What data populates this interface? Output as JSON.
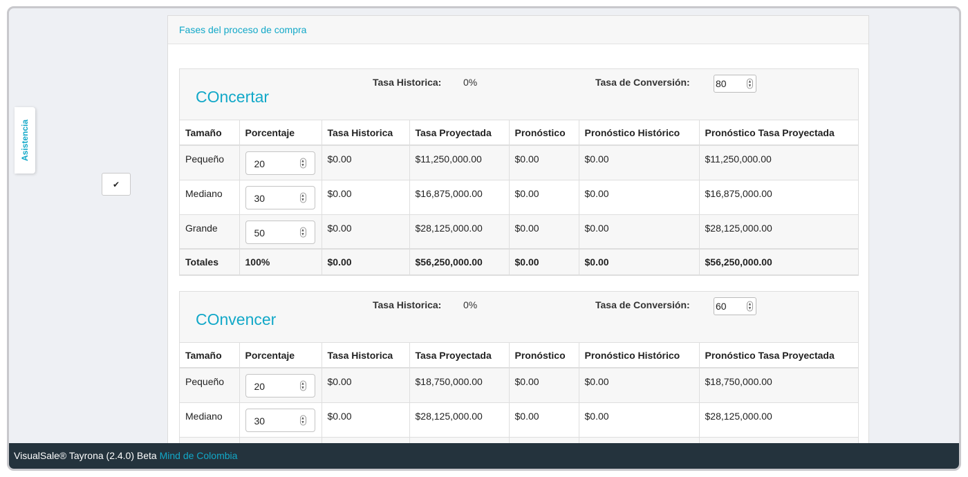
{
  "help_tab": {
    "label": "Asistencia"
  },
  "panel": {
    "title": "Fases del proceso de compra"
  },
  "columns": [
    "Tamaño",
    "Porcentaje",
    "Tasa Historica",
    "Tasa Proyectada",
    "Pronóstico",
    "Pronóstico Histórico",
    "Pronóstico Tasa Proyectada"
  ],
  "phases": [
    {
      "name": "COncertar",
      "hist_label": "Tasa Historica:",
      "hist_value": "0%",
      "conv_label": "Tasa de Conversión:",
      "conv_value": "80",
      "rows": [
        {
          "size": "Pequeño",
          "pct": "20",
          "hist": "$0.00",
          "proj": "$11,250,000.00",
          "forecast": "$0.00",
          "forecast_hist": "$0.00",
          "forecast_proj": "$11,250,000.00"
        },
        {
          "size": "Mediano",
          "pct": "30",
          "hist": "$0.00",
          "proj": "$16,875,000.00",
          "forecast": "$0.00",
          "forecast_hist": "$0.00",
          "forecast_proj": "$16,875,000.00"
        },
        {
          "size": "Grande",
          "pct": "50",
          "hist": "$0.00",
          "proj": "$28,125,000.00",
          "forecast": "$0.00",
          "forecast_hist": "$0.00",
          "forecast_proj": "$28,125,000.00"
        }
      ],
      "totals": {
        "label": "Totales",
        "pct": "100%",
        "hist": "$0.00",
        "proj": "$56,250,000.00",
        "forecast": "$0.00",
        "forecast_hist": "$0.00",
        "forecast_proj": "$56,250,000.00"
      }
    },
    {
      "name": "COnvencer",
      "hist_label": "Tasa Historica:",
      "hist_value": "0%",
      "conv_label": "Tasa de Conversión:",
      "conv_value": "60",
      "rows": [
        {
          "size": "Pequeño",
          "pct": "20",
          "hist": "$0.00",
          "proj": "$18,750,000.00",
          "forecast": "$0.00",
          "forecast_hist": "$0.00",
          "forecast_proj": "$18,750,000.00"
        },
        {
          "size": "Mediano",
          "pct": "30",
          "hist": "$0.00",
          "proj": "$28,125,000.00",
          "forecast": "$0.00",
          "forecast_hist": "$0.00",
          "forecast_proj": "$28,125,000.00"
        }
      ]
    }
  ],
  "footer": {
    "text": "VisualSale® Tayrona (2.4.0) Beta",
    "brand": "Mind de Colombia"
  },
  "icons": {
    "confirm": "check-icon",
    "spinner": "spinner-arrows-icon"
  },
  "colors": {
    "accent": "#12a8c8",
    "footer_bg": "#24333d",
    "background": "#eef0f4"
  }
}
